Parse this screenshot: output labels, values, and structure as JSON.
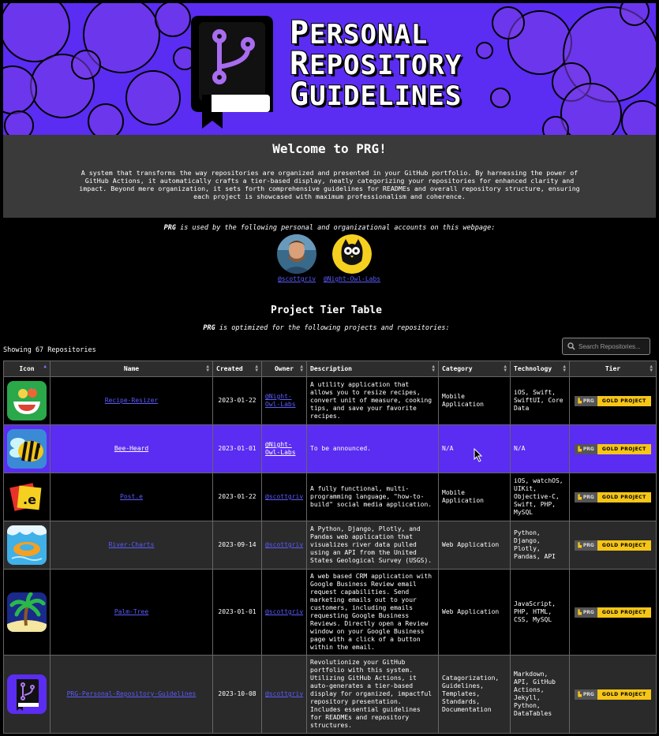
{
  "banner": {
    "title_lines": [
      {
        "first": "P",
        "rest": "ERSONAL"
      },
      {
        "first": "R",
        "rest": "EPOSITORY"
      },
      {
        "first": "G",
        "rest": "UIDELINES"
      }
    ],
    "colors": {
      "background": "#5b2cf2",
      "bubble": "#7a3fe8"
    }
  },
  "welcome": {
    "title": "Welcome to PRG!",
    "text": "A system that transforms the way repositories are organized and presented in your GitHub portfolio. By harnessing the power of GitHub Actions, it automatically crafts a tier-based display, neatly categorizing your repositories for enhanced clarity and impact. Beyond mere organization, it sets forth comprehensive guidelines for READMEs and overall repository structure, ensuring each project is showcased with maximum professionalism and coherence."
  },
  "used_by": {
    "brand": "PRG",
    "text": " is used by the following personal and organizational accounts on this webpage:",
    "accounts": [
      {
        "handle": "@scottgriv",
        "avatar": "person-avatar"
      },
      {
        "handle": "@Night-Owl-Labs",
        "avatar": "owl-avatar"
      }
    ]
  },
  "table_section": {
    "title": "Project Tier Table",
    "brand": "PRG",
    "optimized_text": " is optimized for the following projects and repositories:",
    "showing": "Showing 67 Repositories",
    "search_placeholder": "Search Repositories..."
  },
  "columns": [
    "Icon",
    "Name",
    "Created",
    "Owner",
    "Description",
    "Category",
    "Technology",
    "Tier"
  ],
  "badge": {
    "left": "PRG",
    "right": "GOLD PROJECT"
  },
  "rows": [
    {
      "name": "Recipe-Resizer",
      "created": "2023-01-22",
      "owner": "@Night-Owl-Labs",
      "description": "A utility application that allows you to resize recipes, convert unit of measure, cooking tips, and save your favorite recipes.",
      "category": "Mobile Application",
      "technology": "iOS, Swift, SwiftUI, Core Data",
      "icon": "recipe-bowl-icon"
    },
    {
      "name": "Bee-Heard",
      "created": "2023-01-01",
      "owner": "@Night-Owl-Labs",
      "description": "To be announced.",
      "category": "N/A",
      "technology": "N/A",
      "icon": "bee-icon"
    },
    {
      "name": "Post.e",
      "created": "2023-01-22",
      "owner": "@scottgriv",
      "description": "A fully functional, multi-programming language, \"how-to-build\" social media application.",
      "category": "Mobile Application",
      "technology": "iOS, watchOS, UIKit, Objective-C, Swift, PHP, MySQL",
      "icon": "post-e-icon"
    },
    {
      "name": "River-Charts",
      "created": "2023-09-14",
      "owner": "@scottgriv",
      "description": "A Python, Django, Plotly, and Pandas web application that visualizes river data pulled using an API from the United States Geological Survey (USGS).",
      "category": "Web Application",
      "technology": "Python, Django, Plotly, Pandas, API",
      "icon": "river-tube-icon"
    },
    {
      "name": "Palm-Tree",
      "created": "2023-01-01",
      "owner": "@scottgriv",
      "description": "A web based CRM application with Google Business Review email request capabilities. Send marketing emails out to your customers, including emails requesting Google Business Reviews. Directly open a Review window on your Google Business page with a click of a button within the email.",
      "category": "Web Application",
      "technology": "JavaScript, PHP, HTML, CSS, MySQL",
      "icon": "palm-tree-icon"
    },
    {
      "name": "PRG-Personal-Repository-Guidelines",
      "created": "2023-10-08",
      "owner": "@scottgriv",
      "description": "Revolutionize your GitHub portfolio with this system. Utilizing GitHub Actions, it auto-generates a tier-based display for organized, impactful repository presentation. Includes essential guidelines for READMEs and repository structures.",
      "category": "Catagorization, Guidelines, Templates, Standards, Documentation",
      "technology": "Markdown, API, GitHub Actions, Jekyll, Python, DataTables",
      "icon": "prg-book-icon"
    }
  ]
}
